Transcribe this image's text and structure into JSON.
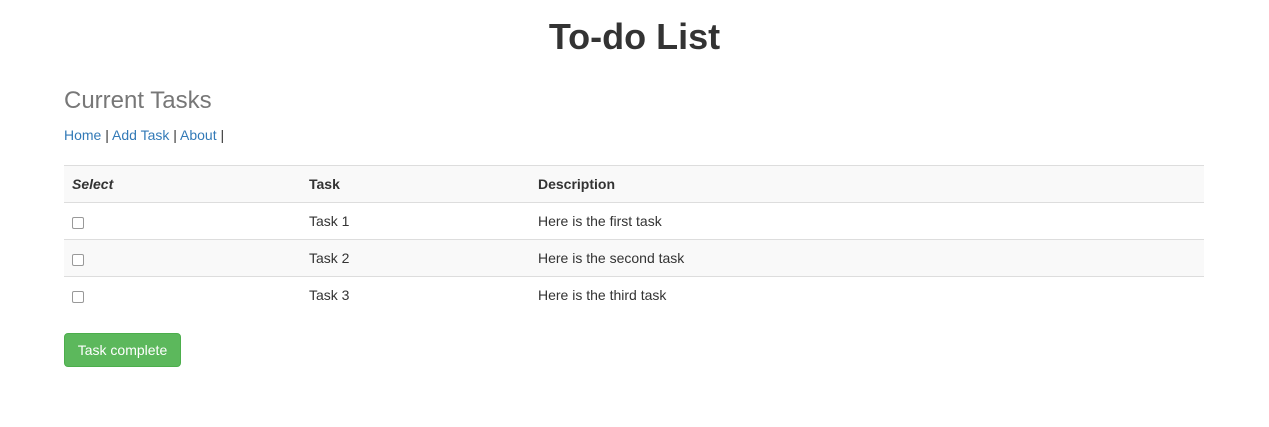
{
  "app": {
    "title": "To-do List"
  },
  "section": {
    "title": "Current Tasks"
  },
  "nav": {
    "links": [
      {
        "label": "Home"
      },
      {
        "label": "Add Task"
      },
      {
        "label": "About"
      }
    ],
    "separator": "|"
  },
  "table": {
    "headers": {
      "select": "Select",
      "task": "Task",
      "description": "Description"
    },
    "rows": [
      {
        "checked": false,
        "task": "Task 1",
        "description": "Here is the first task"
      },
      {
        "checked": false,
        "task": "Task 2",
        "description": "Here is the second task"
      },
      {
        "checked": false,
        "task": "Task 3",
        "description": "Here is the third task"
      }
    ]
  },
  "actions": {
    "complete_label": "Task complete"
  },
  "colors": {
    "link": "#337ab7",
    "success_button": "#5cb85c",
    "subtitle": "#777777",
    "stripe": "#f9f9f9"
  }
}
